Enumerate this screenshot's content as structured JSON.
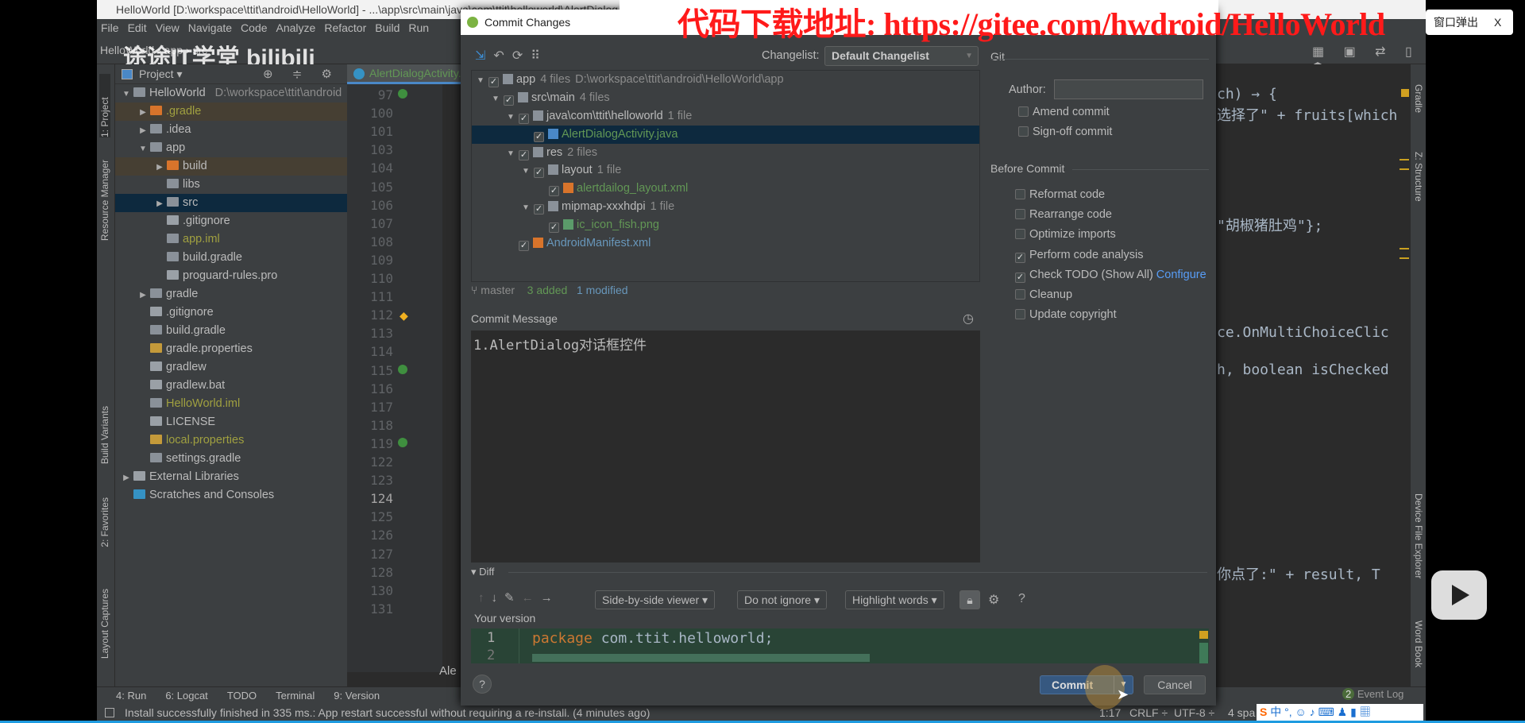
{
  "window": {
    "title": "HelloWorld [D:\\workspace\\ttit\\android\\HelloWorld] - ...\\app\\src\\main\\java\\com\\ttit\\helloworld\\AlertDialogActivity.java"
  },
  "menu": [
    "File",
    "Edit",
    "View",
    "Navigate",
    "Code",
    "Analyze",
    "Refactor",
    "Build",
    "Run"
  ],
  "breadcrumb": [
    "HelloWorld",
    "app",
    "src"
  ],
  "watermark": "途途IT学堂 bilibili",
  "overlay": {
    "text": "代码下载地址: https://gitee.com/hwdroid/HelloWorld",
    "popup": "窗口弹出",
    "popup_close": "X"
  },
  "toolstrip": {
    "left": [
      "1: Project",
      "Resource Manager",
      "Build Variants",
      "2: Favorites",
      "Layout Captures"
    ],
    "right": [
      "Gradle",
      "Z: Structure",
      "Device File Explorer",
      "Word Book"
    ]
  },
  "project": {
    "header": "Project",
    "tree": [
      {
        "label": "HelloWorld",
        "extra": "D:\\workspace\\ttit\\android",
        "depth": 0,
        "arrow": "down",
        "icon": "module",
        "color": "#bbbbbb"
      },
      {
        "label": ".gradle",
        "depth": 1,
        "arrow": "right",
        "icon": "folder-orange",
        "color": "#a0a040",
        "hl": "excluded"
      },
      {
        "label": ".idea",
        "depth": 1,
        "arrow": "right",
        "icon": "folder",
        "color": "#bbbbbb"
      },
      {
        "label": "app",
        "depth": 1,
        "arrow": "down",
        "icon": "module",
        "color": "#bbbbbb"
      },
      {
        "label": "build",
        "depth": 2,
        "arrow": "right",
        "icon": "folder-orange",
        "color": "#bbbbbb",
        "hl": "excluded"
      },
      {
        "label": "libs",
        "depth": 2,
        "icon": "folder",
        "color": "#bbbbbb"
      },
      {
        "label": "src",
        "depth": 2,
        "arrow": "right",
        "icon": "folder",
        "color": "#bbbbbb",
        "hl": "selected"
      },
      {
        "label": ".gitignore",
        "depth": 2,
        "icon": "file",
        "color": "#bbbbbb"
      },
      {
        "label": "app.iml",
        "depth": 2,
        "icon": "module",
        "color": "#a0a040"
      },
      {
        "label": "build.gradle",
        "depth": 2,
        "icon": "gradle",
        "color": "#bbbbbb"
      },
      {
        "label": "proguard-rules.pro",
        "depth": 2,
        "icon": "file",
        "color": "#bbbbbb"
      },
      {
        "label": "gradle",
        "depth": 1,
        "arrow": "right",
        "icon": "folder",
        "color": "#bbbbbb"
      },
      {
        "label": ".gitignore",
        "depth": 1,
        "icon": "file",
        "color": "#bbbbbb"
      },
      {
        "label": "build.gradle",
        "depth": 1,
        "icon": "gradle",
        "color": "#bbbbbb"
      },
      {
        "label": "gradle.properties",
        "depth": 1,
        "icon": "properties",
        "color": "#bbbbbb"
      },
      {
        "label": "gradlew",
        "depth": 1,
        "icon": "file",
        "color": "#bbbbbb"
      },
      {
        "label": "gradlew.bat",
        "depth": 1,
        "icon": "file",
        "color": "#bbbbbb"
      },
      {
        "label": "HelloWorld.iml",
        "depth": 1,
        "icon": "module",
        "color": "#a0a040"
      },
      {
        "label": "LICENSE",
        "depth": 1,
        "icon": "file",
        "color": "#bbbbbb"
      },
      {
        "label": "local.properties",
        "depth": 1,
        "icon": "properties",
        "color": "#a0a040"
      },
      {
        "label": "settings.gradle",
        "depth": 1,
        "icon": "gradle",
        "color": "#bbbbbb"
      },
      {
        "label": "External Libraries",
        "depth": 0,
        "arrow": "right",
        "icon": "libraries",
        "color": "#bbbbbb"
      },
      {
        "label": "Scratches and Consoles",
        "depth": 0,
        "icon": "scratches",
        "color": "#bbbbbb"
      }
    ]
  },
  "editor": {
    "tab": "AlertDialogActivity.java",
    "line_numbers": [
      "97",
      "100",
      "101",
      "103",
      "104",
      "105",
      "106",
      "107",
      "108",
      "109",
      "110",
      "111",
      "112",
      "113",
      "114",
      "115",
      "116",
      "117",
      "118",
      "119",
      "122",
      "123",
      "124",
      "125",
      "126",
      "127",
      "128",
      "130",
      "131"
    ],
    "code_fragments": [
      {
        "row": 0,
        "text": "ch) → {"
      },
      {
        "row": 1,
        "text": "选择了\" + fruits[which"
      },
      {
        "row": 7,
        "text": "\"胡椒猪肚鸡\"};"
      },
      {
        "row": 13,
        "text": "ce.OnMultiChoiceClic"
      },
      {
        "row": 15,
        "text": "h, boolean isChecked"
      },
      {
        "row": 26,
        "text": "你点了:\" + result, T"
      }
    ],
    "bottom_tab_fragment": "Ale"
  },
  "bottom_tools": [
    "4: Run",
    "6: Logcat",
    "TODO",
    "Terminal",
    "9: Version"
  ],
  "status": {
    "message": "Install successfully finished in 335 ms.: App restart successful without requiring a re-install. (4 minutes ago)",
    "position": "1:17",
    "line_sep": "CRLF ÷",
    "encoding": "UTF-8 ÷",
    "indent": "4 spa",
    "event_log": "Event Log",
    "event_count": "2"
  },
  "dialog": {
    "title": "Commit Changes",
    "changelist_label": "Changelist:",
    "changelist_value": "Default Changelist",
    "tree": [
      {
        "label": "app",
        "count": "4 files",
        "path": "D:\\workspace\\ttit\\android\\HelloWorld\\app",
        "depth": 0,
        "arrow": true,
        "icon": "module",
        "color": "#bbbbbb"
      },
      {
        "label": "src\\main",
        "count": "4 files",
        "depth": 1,
        "arrow": true,
        "icon": "folder",
        "color": "#bbbbbb"
      },
      {
        "label": "java\\com\\ttit\\helloworld",
        "count": "1 file",
        "depth": 2,
        "arrow": true,
        "icon": "folder",
        "color": "#bbbbbb"
      },
      {
        "label": "AlertDialogActivity.java",
        "depth": 3,
        "icon": "java",
        "color": "#629755",
        "selected": true
      },
      {
        "label": "res",
        "count": "2 files",
        "depth": 2,
        "arrow": true,
        "icon": "folder",
        "color": "#bbbbbb"
      },
      {
        "label": "layout",
        "count": "1 file",
        "depth": 3,
        "arrow": true,
        "icon": "folder",
        "color": "#bbbbbb"
      },
      {
        "label": "alertdailog_layout.xml",
        "depth": 4,
        "icon": "xml",
        "color": "#629755"
      },
      {
        "label": "mipmap-xxxhdpi",
        "count": "1 file",
        "depth": 3,
        "arrow": true,
        "icon": "folder",
        "color": "#bbbbbb"
      },
      {
        "label": "ic_icon_fish.png",
        "depth": 4,
        "icon": "image",
        "color": "#629755"
      },
      {
        "label": "AndroidManifest.xml",
        "depth": 2,
        "icon": "xml",
        "color": "#6897bb"
      }
    ],
    "branch": "master",
    "added": "3 added",
    "modified": "1 modified",
    "commit_message_label": "Commit Message",
    "commit_message": "1.AlertDialog对话框控件",
    "git_label": "Git",
    "author_label": "Author:",
    "author_value": "",
    "git_options": [
      {
        "label": "Amend commit",
        "checked": false
      },
      {
        "label": "Sign-off commit",
        "checked": false
      }
    ],
    "before_commit_label": "Before Commit",
    "before_commit": [
      {
        "label": "Reformat code",
        "checked": false
      },
      {
        "label": "Rearrange code",
        "checked": false
      },
      {
        "label": "Optimize imports",
        "checked": false
      },
      {
        "label": "Perform code analysis",
        "checked": true
      },
      {
        "label": "Check TODO (Show All)",
        "checked": true,
        "link": "Configure"
      },
      {
        "label": "Cleanup",
        "checked": false
      },
      {
        "label": "Update copyright",
        "checked": false
      }
    ],
    "diff_label": "Diff",
    "viewer": "Side-by-side viewer ▾",
    "ignore": "Do not ignore ▾",
    "highlight": "Highlight words ▾",
    "your_version": "Your version",
    "diff_lines": [
      {
        "n": "1",
        "kw": "package",
        "rest": " com.ttit.helloworld;"
      },
      {
        "n": "2",
        "kw": "",
        "rest": ""
      }
    ],
    "commit_button": "Commit",
    "cancel_button": "Cancel",
    "help": "?"
  },
  "colors": {
    "accent": "#365880",
    "added": "#629755",
    "modified": "#6897bb",
    "selection": "#0d293e"
  }
}
